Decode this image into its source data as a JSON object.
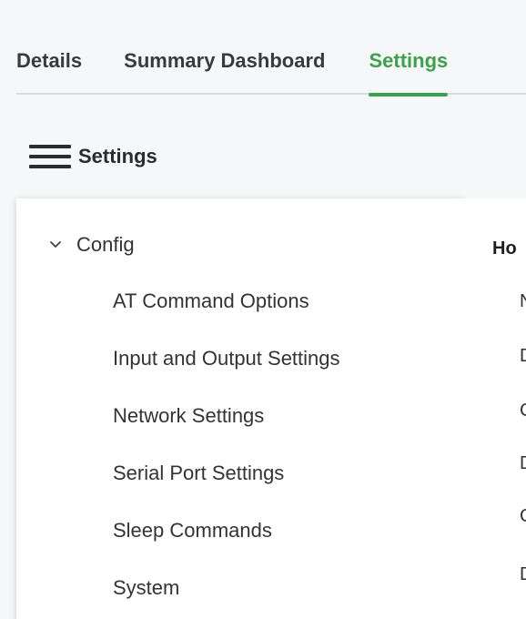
{
  "tabs": [
    {
      "label": "Details"
    },
    {
      "label": "Summary Dashboard"
    },
    {
      "label": "Settings",
      "active": true
    }
  ],
  "settings_header": {
    "title": "Settings",
    "menu_icon": "hamburger-menu-icon"
  },
  "nav": {
    "group": {
      "label": "Config",
      "expanded": true,
      "icon": "chevron-down-icon"
    },
    "items": [
      {
        "label": "AT Command Options"
      },
      {
        "label": "Input and Output Settings"
      },
      {
        "label": "Network Settings"
      },
      {
        "label": "Serial Port Settings"
      },
      {
        "label": "Sleep Commands"
      },
      {
        "label": "System"
      }
    ]
  },
  "content": {
    "heading": "Ho",
    "rows": [
      "N",
      "D",
      "C",
      "D",
      "C",
      "D"
    ]
  },
  "colors": {
    "accent": "#3aa34a",
    "background": "#f6f7f8",
    "panel": "#ffffff",
    "divider": "#d9dcdf"
  }
}
